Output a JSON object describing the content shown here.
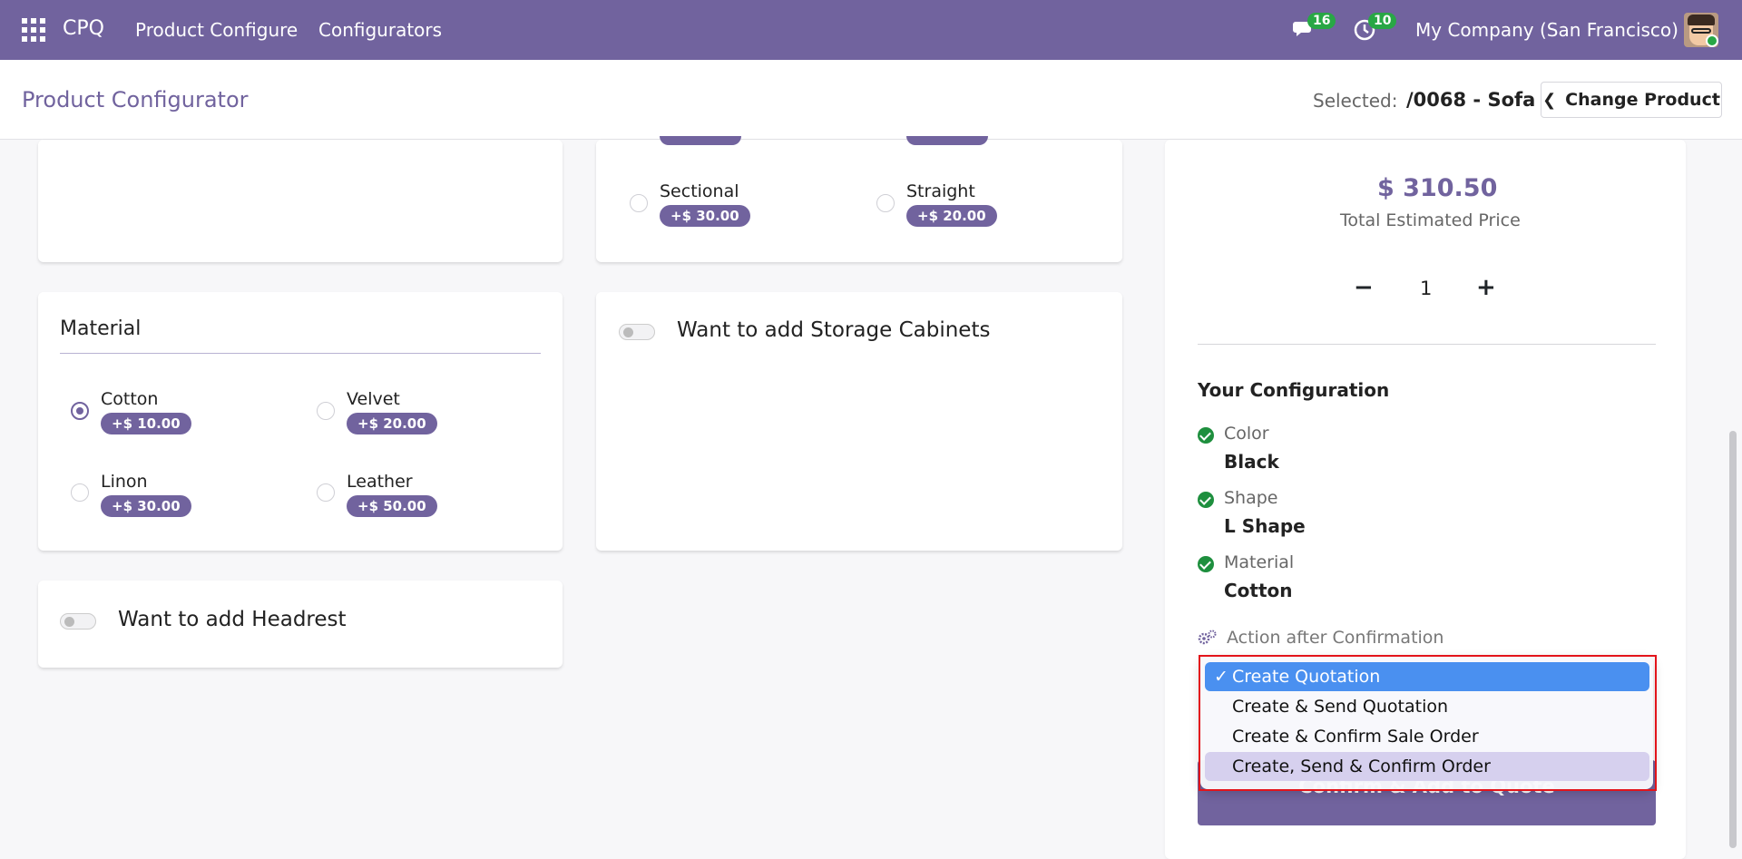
{
  "topbar": {
    "app_name": "CPQ",
    "nav": [
      "Product Configure",
      "Configurators"
    ],
    "chat_badge": "16",
    "activity_badge": "10",
    "company": "My Company (San Francisco)"
  },
  "header": {
    "title": "Product Configurator",
    "selected_label": "Selected:",
    "selected_value": "/0068 - Sofa",
    "change_button": "Change Product"
  },
  "shape_options": [
    {
      "label": "Sectional",
      "price": "+$ 30.00",
      "checked": false
    },
    {
      "label": "Straight",
      "price": "+$ 20.00",
      "checked": false
    }
  ],
  "material": {
    "title": "Material",
    "options": [
      {
        "label": "Cotton",
        "price": "+$ 10.00",
        "checked": true
      },
      {
        "label": "Velvet",
        "price": "+$ 20.00",
        "checked": false
      },
      {
        "label": "Linon",
        "price": "+$ 30.00",
        "checked": false
      },
      {
        "label": "Leather",
        "price": "+$ 50.00",
        "checked": false
      }
    ]
  },
  "toggles": {
    "storage": "Want to add Storage Cabinets",
    "headrest": "Want to add Headrest"
  },
  "summary": {
    "price": "$ 310.50",
    "price_label": "Total Estimated Price",
    "quantity": "1",
    "minus": "−",
    "plus": "+",
    "config_title": "Your Configuration",
    "items": [
      {
        "label": "Color",
        "value": "Black"
      },
      {
        "label": "Shape",
        "value": "L Shape"
      },
      {
        "label": "Material",
        "value": "Cotton"
      }
    ],
    "action_label": "Action after Confirmation",
    "confirm_button": "Confirm & Add to Quote"
  },
  "dropdown": {
    "options": [
      "Create Quotation",
      "Create & Send Quotation",
      "Create & Confirm Sale Order",
      "Create, Send & Confirm Order"
    ],
    "selected": "Create Quotation",
    "check": "✓"
  },
  "colors": {
    "brand": "#71639e",
    "success": "#1e8f3e",
    "highlight": "#e3141b",
    "selection": "#4a90f0"
  }
}
